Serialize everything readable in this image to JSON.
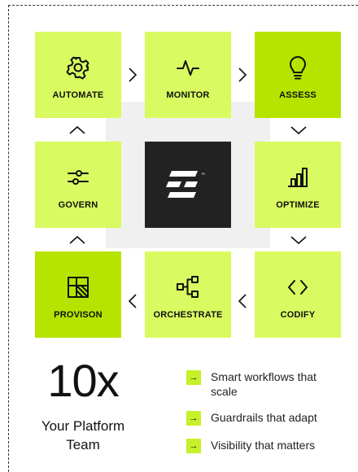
{
  "tiles": {
    "automate": {
      "label": "AUTOMATE",
      "icon": "gear-icon"
    },
    "monitor": {
      "label": "MONITOR",
      "icon": "pulse-icon"
    },
    "assess": {
      "label": "ASSESS",
      "icon": "lightbulb-icon"
    },
    "govern": {
      "label": "GOVERN",
      "icon": "sliders-icon"
    },
    "optimize": {
      "label": "OPTIMIZE",
      "icon": "bar-chart-icon"
    },
    "provison": {
      "label": "PROVISON",
      "icon": "grid-icon"
    },
    "orchestrate": {
      "label": "ORCHESTRATE",
      "icon": "workflow-icon"
    },
    "codify": {
      "label": "CODIFY",
      "icon": "code-brackets-icon"
    }
  },
  "center_logo": {
    "icon": "brand-logo-icon",
    "mark": "™"
  },
  "headline": {
    "value": "10x",
    "tagline": "Your Platform Team"
  },
  "benefits": [
    {
      "text": "Smart workflows that scale",
      "icon": "arrow-right-icon",
      "glyph": "→"
    },
    {
      "text": "Guardrails that adapt",
      "icon": "arrow-right-icon",
      "glyph": "→"
    },
    {
      "text": "Visibility that matters",
      "icon": "arrow-right-icon",
      "glyph": "→"
    }
  ],
  "colors": {
    "tile_light": "#d9fa60",
    "tile_dark": "#b6e400",
    "logo_bg": "#222222",
    "accent": "#c6f12a"
  }
}
